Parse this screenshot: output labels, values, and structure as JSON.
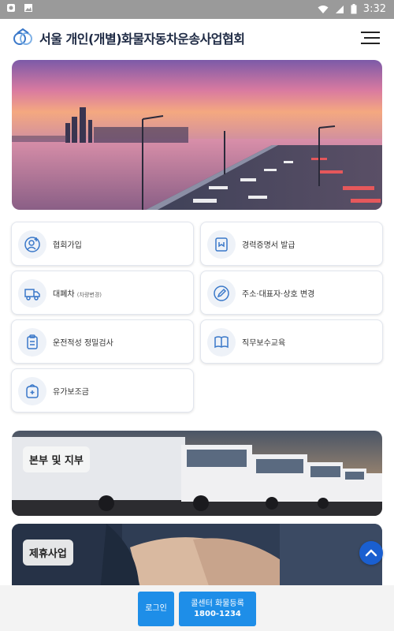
{
  "status_bar": {
    "time": "3:32"
  },
  "app": {
    "title": "서울 개인(개별)화물자동차운송사업협회"
  },
  "menu_cards": [
    {
      "label": "협회가입",
      "icon": "user-add-icon"
    },
    {
      "label": "경력증명서 발급",
      "icon": "certificate-icon"
    },
    {
      "label": "대폐차",
      "sub": "(차량변경)",
      "icon": "truck-icon"
    },
    {
      "label": "주소·대표자·상호 변경",
      "icon": "pencil-icon"
    },
    {
      "label": "운전적성 정밀검사",
      "icon": "clipboard-icon"
    },
    {
      "label": "직무보수교육",
      "icon": "book-icon"
    },
    {
      "label": "유가보조금",
      "icon": "wallet-icon"
    }
  ],
  "banners": {
    "branches": "본부 및 지부",
    "partners": "제휴사업"
  },
  "bottom": {
    "login": "로그인",
    "call_label": "콜센터 화물등록",
    "call_number": "1800-1234"
  },
  "colors": {
    "accent": "#1e8ee8",
    "title": "#1e2a44",
    "scroll_button": "#1a5fd0"
  }
}
